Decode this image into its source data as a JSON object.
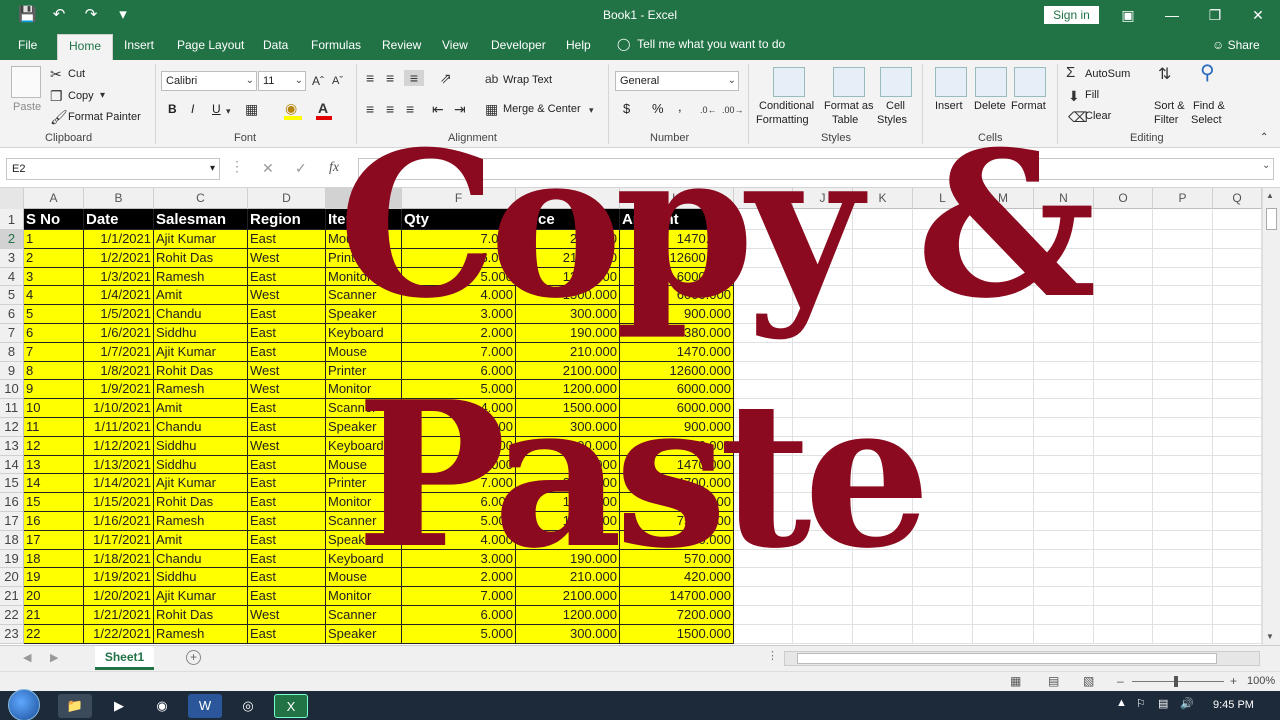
{
  "title_bar": {
    "document_title": "Book1  -  Excel",
    "sign_in_label": "Sign in",
    "qat_icons": [
      "save-icon",
      "undo-icon",
      "redo-icon",
      "customize-icon"
    ]
  },
  "tabs": [
    "File",
    "Home",
    "Insert",
    "Page Layout",
    "Data",
    "Formulas",
    "Review",
    "View",
    "Developer",
    "Help"
  ],
  "active_tab": "Home",
  "tell_me": "Tell me what you want to do",
  "share_label": "Share",
  "ribbon": {
    "clipboard": {
      "paste": "Paste",
      "cut": "Cut",
      "copy": "Copy",
      "format_painter": "Format Painter",
      "group": "Clipboard"
    },
    "font": {
      "name": "Calibri",
      "size": "11",
      "bold": "B",
      "italic": "I",
      "underline": "U",
      "group": "Font"
    },
    "alignment": {
      "wrap_text": "Wrap Text",
      "merge_center": "Merge & Center",
      "group": "Alignment"
    },
    "number": {
      "format": "General",
      "currency": "$",
      "percent": "%",
      "comma": ",",
      "group": "Number"
    },
    "styles": {
      "conditional_1": "Conditional",
      "conditional_2": "Formatting",
      "format_table_1": "Format as",
      "format_table_2": "Table",
      "cell_styles_1": "Cell",
      "cell_styles_2": "Styles",
      "group": "Styles"
    },
    "cells": {
      "insert": "Insert",
      "delete": "Delete",
      "format": "Format",
      "group": "Cells"
    },
    "editing": {
      "autosum": "AutoSum",
      "fill": "Fill",
      "clear": "Clear",
      "sort_1": "Sort &",
      "sort_2": "Filter",
      "find_1": "Find &",
      "find_2": "Select",
      "group": "Editing"
    }
  },
  "name_box": "E2",
  "fx_label": "fx",
  "columns": [
    "A",
    "B",
    "C",
    "D",
    "E",
    "F",
    "G",
    "H",
    "I",
    "J",
    "K",
    "L",
    "M",
    "N",
    "O",
    "P",
    "Q"
  ],
  "row_numbers": [
    "1",
    "2",
    "3",
    "4",
    "5",
    "6",
    "7",
    "8",
    "9",
    "10",
    "11",
    "12",
    "13",
    "14",
    "15",
    "16",
    "17",
    "18",
    "19",
    "20",
    "21",
    "22",
    "23"
  ],
  "header_row": [
    "S No",
    "Date",
    "Salesman",
    "Region",
    "Item",
    "Qty",
    "Price",
    "Amount"
  ],
  "rows": [
    [
      "1",
      "1/1/2021",
      "Ajit Kumar",
      "East",
      "Mouse",
      "7.000",
      "210.000",
      "1470.000"
    ],
    [
      "2",
      "1/2/2021",
      "Rohit Das",
      "West",
      "Printer",
      "6.000",
      "2100.000",
      "12600.000"
    ],
    [
      "3",
      "1/3/2021",
      "Ramesh",
      "East",
      "Monitor",
      "5.000",
      "1200.000",
      "6000.000"
    ],
    [
      "4",
      "1/4/2021",
      "Amit",
      "West",
      "Scanner",
      "4.000",
      "1500.000",
      "6000.000"
    ],
    [
      "5",
      "1/5/2021",
      "Chandu",
      "East",
      "Speaker",
      "3.000",
      "300.000",
      "900.000"
    ],
    [
      "6",
      "1/6/2021",
      "Siddhu",
      "East",
      "Keyboard",
      "2.000",
      "190.000",
      "380.000"
    ],
    [
      "7",
      "1/7/2021",
      "Ajit Kumar",
      "East",
      "Mouse",
      "7.000",
      "210.000",
      "1470.000"
    ],
    [
      "8",
      "1/8/2021",
      "Rohit Das",
      "West",
      "Printer",
      "6.000",
      "2100.000",
      "12600.000"
    ],
    [
      "9",
      "1/9/2021",
      "Ramesh",
      "West",
      "Monitor",
      "5.000",
      "1200.000",
      "6000.000"
    ],
    [
      "10",
      "1/10/2021",
      "Amit",
      "East",
      "Scanner",
      "4.000",
      "1500.000",
      "6000.000"
    ],
    [
      "11",
      "1/11/2021",
      "Chandu",
      "East",
      "Speaker",
      "3.000",
      "300.000",
      "900.000"
    ],
    [
      "12",
      "1/12/2021",
      "Siddhu",
      "West",
      "Keyboard",
      "2.000",
      "190.000",
      "380.000"
    ],
    [
      "13",
      "1/13/2021",
      "Siddhu",
      "East",
      "Mouse",
      "7.000",
      "210.000",
      "1470.000"
    ],
    [
      "14",
      "1/14/2021",
      "Ajit Kumar",
      "East",
      "Printer",
      "7.000",
      "2100.000",
      "14700.000"
    ],
    [
      "15",
      "1/15/2021",
      "Rohit Das",
      "East",
      "Monitor",
      "6.000",
      "1200.000",
      "7200.000"
    ],
    [
      "16",
      "1/16/2021",
      "Ramesh",
      "East",
      "Scanner",
      "5.000",
      "1500.000",
      "7500.000"
    ],
    [
      "17",
      "1/17/2021",
      "Amit",
      "East",
      "Speaker",
      "4.000",
      "300.000",
      "1200.000"
    ],
    [
      "18",
      "1/18/2021",
      "Chandu",
      "East",
      "Keyboard",
      "3.000",
      "190.000",
      "570.000"
    ],
    [
      "19",
      "1/19/2021",
      "Siddhu",
      "East",
      "Mouse",
      "2.000",
      "210.000",
      "420.000"
    ],
    [
      "20",
      "1/20/2021",
      "Ajit Kumar",
      "East",
      "Monitor",
      "7.000",
      "2100.000",
      "14700.000"
    ],
    [
      "21",
      "1/21/2021",
      "Rohit Das",
      "West",
      "Scanner",
      "6.000",
      "1200.000",
      "7200.000"
    ],
    [
      "22",
      "1/22/2021",
      "Ramesh",
      "East",
      "Speaker",
      "5.000",
      "300.000",
      "1500.000"
    ]
  ],
  "sheet_tab": "Sheet1",
  "add_sheet": "+",
  "zoom": "100%",
  "overlay": {
    "line1": "Copy &",
    "line2": "Paste",
    "color": "#8b0a1f"
  },
  "clock": "9:45 PM",
  "colors": {
    "excel_green": "#217346",
    "cell_yellow": "#ffff00",
    "header_black": "#000000"
  }
}
